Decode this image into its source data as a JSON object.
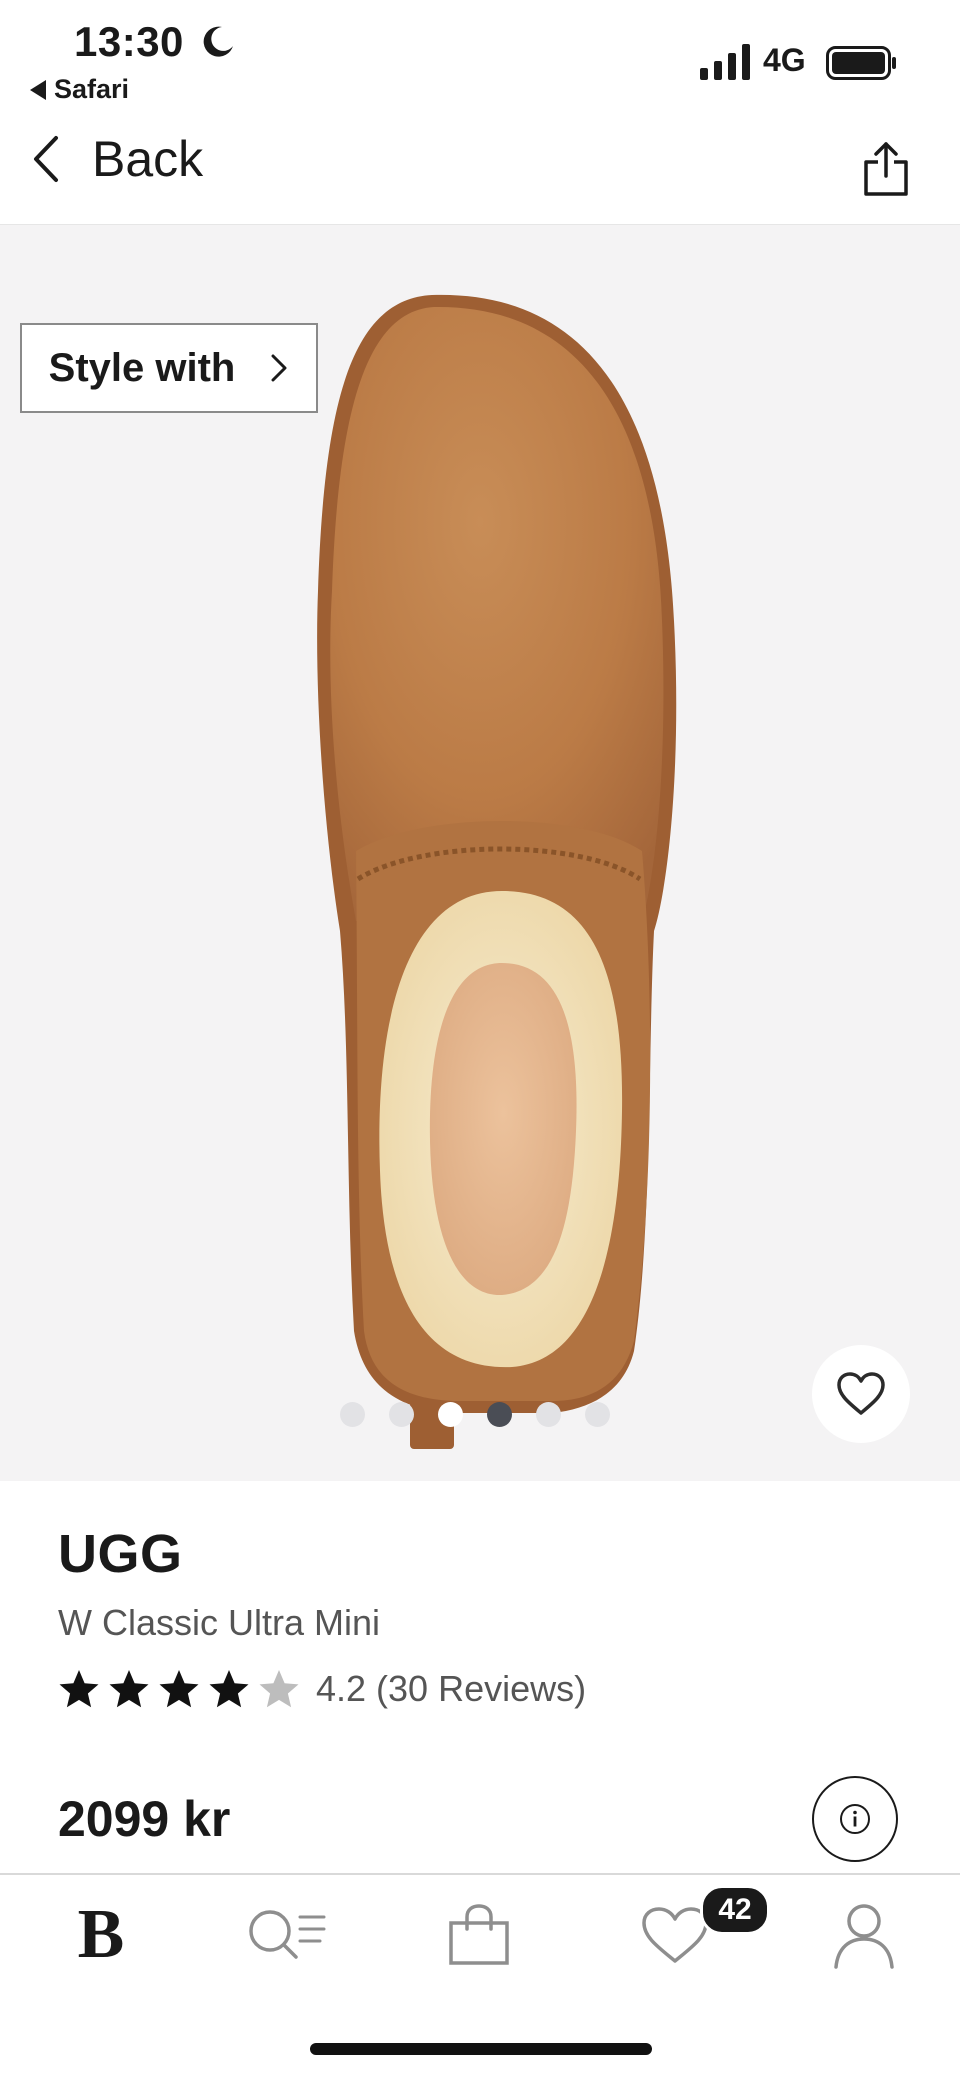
{
  "status_bar": {
    "time": "13:30",
    "back_app": "Safari",
    "network": "4G"
  },
  "nav": {
    "back_label": "Back"
  },
  "gallery": {
    "style_with_label": "Style with",
    "image_count": 6,
    "active_index": 3
  },
  "product": {
    "brand": "UGG",
    "name": "W Classic Ultra Mini",
    "rating_value": 4.2,
    "rating_text": "4.2 (30 Reviews)",
    "price": "2099 kr"
  },
  "tabbar": {
    "home_label": "B",
    "wishlist_count": "42"
  },
  "colors": {
    "gallery_bg": "#f4f3f4",
    "suede": "#bd7f4a",
    "fleece": "#f1dfb6",
    "active_dot": "#4a4d55"
  }
}
